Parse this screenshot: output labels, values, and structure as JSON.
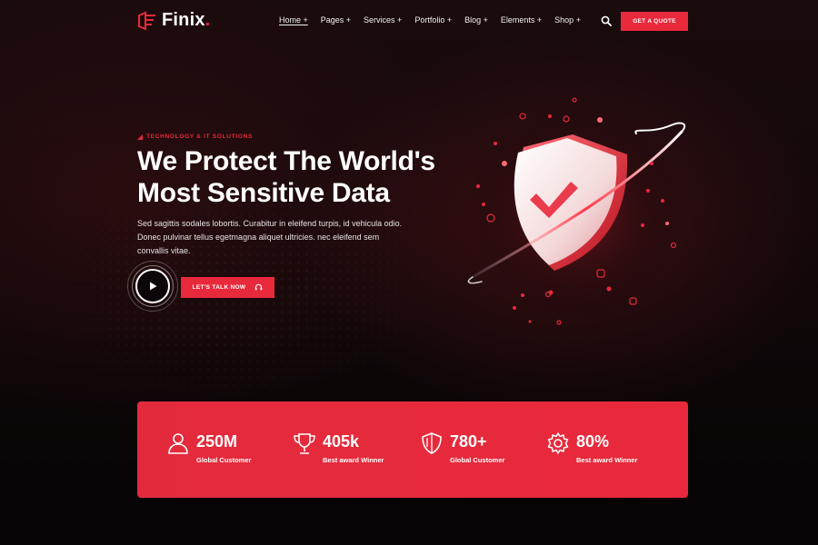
{
  "brand": {
    "name": "Finix",
    "dot": ".",
    "accent": "#e8293b"
  },
  "nav": {
    "items": [
      {
        "label": "Home +"
      },
      {
        "label": "Pages +"
      },
      {
        "label": "Services +"
      },
      {
        "label": "Portfolio +"
      },
      {
        "label": "Blog +"
      },
      {
        "label": "Elements +"
      },
      {
        "label": "Shop +"
      }
    ],
    "search_icon": "search-icon",
    "cta": "GET A QUOTE"
  },
  "hero": {
    "eyebrow": "TECHNOLOGY & IT SOLUTIONS",
    "title_line1": "We Protect The World's",
    "title_line2": "Most Sensitive Data",
    "desc_line1": "Sed sagittis sodales lobortis. Curabitur in eleifend turpis, id vehicula odio.",
    "desc_line2": "Donec pulvinar tellus egetmagna aliquet ultricies. nec eleifend sem",
    "desc_line3": "convallis vitae.",
    "play_icon": "play-icon",
    "talk_button": "LET'S TALK NOW",
    "talk_icon": "headset-icon",
    "illustration_icon": "shield-check-icon"
  },
  "stats": [
    {
      "icon": "user-icon",
      "value": "250M",
      "label": "Global Customer"
    },
    {
      "icon": "trophy-icon",
      "value": "405k",
      "label": "Best award Winner"
    },
    {
      "icon": "shield-icon",
      "value": "780+",
      "label": "Global Customer"
    },
    {
      "icon": "gear-icon",
      "value": "80%",
      "label": "Best award Winner"
    }
  ]
}
